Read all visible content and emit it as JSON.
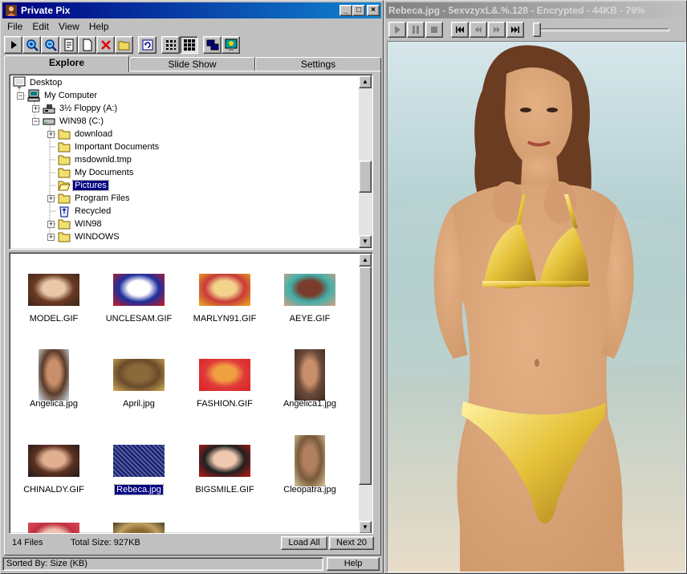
{
  "left_window": {
    "title": "Private Pix",
    "caption_buttons": {
      "minimize": "_",
      "maximize": "□",
      "close": "×"
    },
    "menu": [
      "File",
      "Edit",
      "View",
      "Help"
    ],
    "toolbar_icons": [
      "play-icon",
      "zoom-in-icon",
      "zoom-out-icon",
      "properties-icon",
      "new-icon",
      "delete-icon",
      "open-folder-icon",
      "refresh-icon",
      "view-list-icon",
      "view-thumbnails-icon",
      "window-icon",
      "settings-monitor-icon"
    ],
    "tabs": [
      "Explore",
      "Slide Show",
      "Settings"
    ],
    "active_tab": "Explore",
    "tree": [
      {
        "label": "Desktop",
        "level": 0,
        "icon": "desktop-icon",
        "expander": ""
      },
      {
        "label": "My Computer",
        "level": 1,
        "icon": "computer-icon",
        "expander": "−"
      },
      {
        "label": "3½ Floppy (A:)",
        "level": 2,
        "icon": "floppy-icon",
        "expander": "+"
      },
      {
        "label": "WIN98 (C:)",
        "level": 2,
        "icon": "drive-icon",
        "expander": "−"
      },
      {
        "label": "download",
        "level": 3,
        "icon": "folder-icon",
        "expander": "+"
      },
      {
        "label": "Important Documents",
        "level": 3,
        "icon": "folder-icon",
        "expander": ""
      },
      {
        "label": "msdownld.tmp",
        "level": 3,
        "icon": "folder-icon",
        "expander": ""
      },
      {
        "label": "My Documents",
        "level": 3,
        "icon": "folder-icon",
        "expander": ""
      },
      {
        "label": "Pictures",
        "level": 3,
        "icon": "folder-open-icon",
        "expander": "",
        "selected": true
      },
      {
        "label": "Program Files",
        "level": 3,
        "icon": "folder-icon",
        "expander": "+"
      },
      {
        "label": "Recycled",
        "level": 3,
        "icon": "recycle-bin-icon",
        "expander": ""
      },
      {
        "label": "WIN98",
        "level": 3,
        "icon": "folder-icon",
        "expander": "+"
      },
      {
        "label": "WINDOWS",
        "level": 3,
        "icon": "folder-icon",
        "expander": "+"
      }
    ],
    "thumbnails": [
      {
        "name": "MODEL.GIF",
        "colors": [
          "#3a2418",
          "#e9c7a8",
          "#6b3a22"
        ]
      },
      {
        "name": "UNCLESAM.GIF",
        "colors": [
          "#c81e1e",
          "#ffffff",
          "#1e2e9c"
        ]
      },
      {
        "name": "MARLYN91.GIF",
        "colors": [
          "#e8b020",
          "#f3d38c",
          "#c83a3a"
        ]
      },
      {
        "name": "AEYE.GIF",
        "colors": [
          "#d4a088",
          "#7a3c2c",
          "#40b0a8"
        ]
      },
      {
        "name": "Angelica.jpg",
        "colors": [
          "#d8e4ec",
          "#c98f6a",
          "#5a3a2a"
        ]
      },
      {
        "name": "April.jpg",
        "colors": [
          "#d2ae58",
          "#8a6a3a",
          "#6a4a2a"
        ]
      },
      {
        "name": "FASHION.GIF",
        "colors": [
          "#d82020",
          "#f0a040",
          "#e03a3a"
        ]
      },
      {
        "name": "Angelica1.jpg",
        "colors": [
          "#3a2a20",
          "#c98f6a",
          "#6a4a3a"
        ]
      },
      {
        "name": "CHINALDY.GIF",
        "colors": [
          "#201818",
          "#e0b090",
          "#5a3020"
        ]
      },
      {
        "name": "Rebeca.jpg",
        "colors": [
          "#1a1a6a",
          "#5060a0",
          "#8090c0"
        ],
        "selected": true
      },
      {
        "name": "BIGSMILE.GIF",
        "colors": [
          "#c01818",
          "#f0c8b0",
          "#202020"
        ]
      },
      {
        "name": "Cleopatra.jpg",
        "colors": [
          "#d8c8a0",
          "#b08060",
          "#7a5a3a"
        ]
      },
      {
        "name": "",
        "colors": [
          "#e05060",
          "#f0c0b0",
          "#c03040"
        ]
      },
      {
        "name": "",
        "colors": [
          "#2a2010",
          "#8a6a30",
          "#c0a060"
        ]
      }
    ],
    "file_count": "14 Files",
    "total_size": "Total Size: 927KB",
    "load_all_label": "Load All",
    "next_label": "Next 20",
    "sorted_by": "Sorted By: Size (KB)",
    "help_label": "Help"
  },
  "right_window": {
    "title": "Rebeca.jpg - 5exvzyxL&.%.128 - Encrypted - 44KB - 79%",
    "player_buttons": [
      "play-icon",
      "pause-icon",
      "stop-icon",
      "first-icon",
      "previous-icon",
      "next-icon",
      "last-icon"
    ],
    "slider_position": 0.0,
    "photo_colors": {
      "sky": "#d6e6ea",
      "sea": "#a8c8c8",
      "sand": "#e8dcc8",
      "skin": "#d09a6c",
      "bikini": "#e6c23a",
      "hair": "#6a3c22"
    }
  }
}
